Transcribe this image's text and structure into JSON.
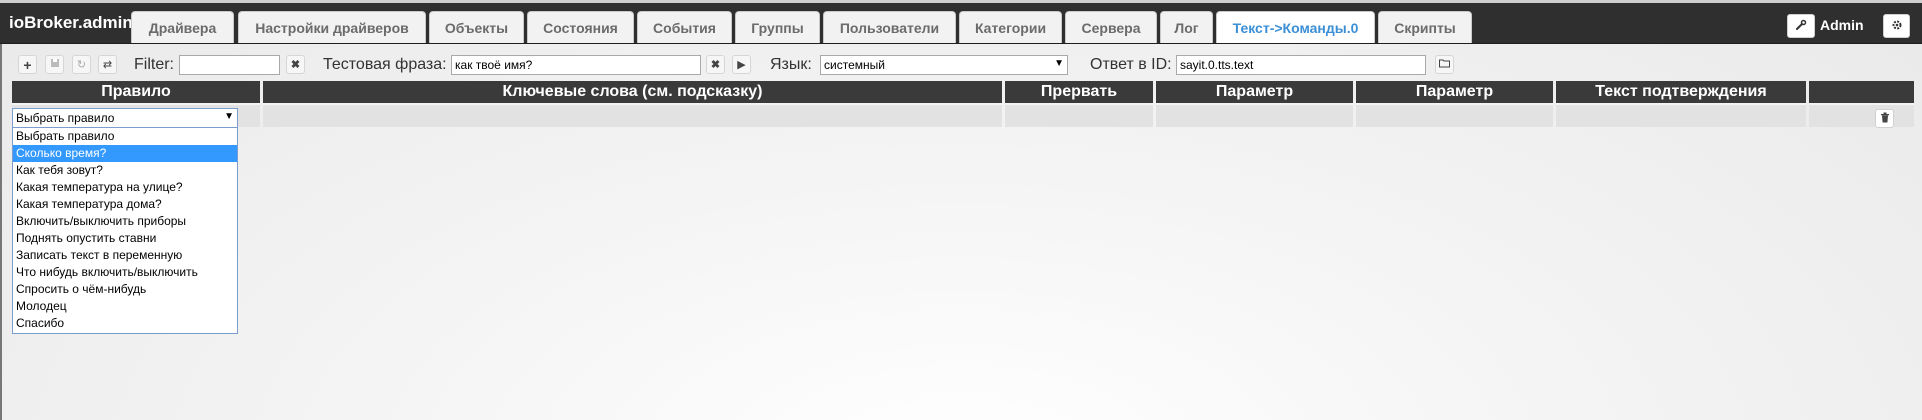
{
  "brand": "ioBroker.admin",
  "tabs": [
    {
      "label": "Драйвера"
    },
    {
      "label": "Настройки драйверов"
    },
    {
      "label": "Объекты"
    },
    {
      "label": "Состояния"
    },
    {
      "label": "События"
    },
    {
      "label": "Группы"
    },
    {
      "label": "Пользователи"
    },
    {
      "label": "Категории"
    },
    {
      "label": "Сервера"
    },
    {
      "label": "Лог"
    },
    {
      "label": "Текст->Команды.0",
      "active": true
    },
    {
      "label": "Скрипты"
    }
  ],
  "header": {
    "user": "Admin",
    "edit_icon": "wrench-icon",
    "settings_icon": "gear-icon"
  },
  "toolbar": {
    "add_icon": "plus-icon",
    "save_icon": "save-icon",
    "refresh_icon": "refresh-icon",
    "swap_icon": "swap-icon",
    "filter_label": "Filter:",
    "filter_value": "",
    "clear_icon": "close-icon",
    "test_phrase_label": "Тестовая фраза:",
    "test_phrase_value": "как твоё имя?",
    "play_icon": "play-icon",
    "language_label": "Язык:",
    "language_value": "системный",
    "answer_id_label": "Ответ в ID:",
    "answer_id_value": "sayit.0.tts.text",
    "folder_icon": "folder-icon"
  },
  "table": {
    "columns": [
      "Правило",
      "Ключевые слова (см. подсказку)",
      "Прервать",
      "Параметр",
      "Параметр",
      "Текст подтверждения",
      ""
    ]
  },
  "rule_select": {
    "selected": "Выбрать правило",
    "options": [
      "Выбрать правило",
      "Сколько время?",
      "Как тебя зовут?",
      "Какая температура на улице?",
      "Какая температура дома?",
      "Включить/выключить приборы",
      "Поднять опустить ставни",
      "Записать текст в переменную",
      "Что нибудь включить/выключить",
      "Спросить о чём-нибудь",
      "Молодец",
      "Спасибо"
    ],
    "highlighted_index": 1
  },
  "row_actions": {
    "delete_icon": "trash-icon"
  }
}
